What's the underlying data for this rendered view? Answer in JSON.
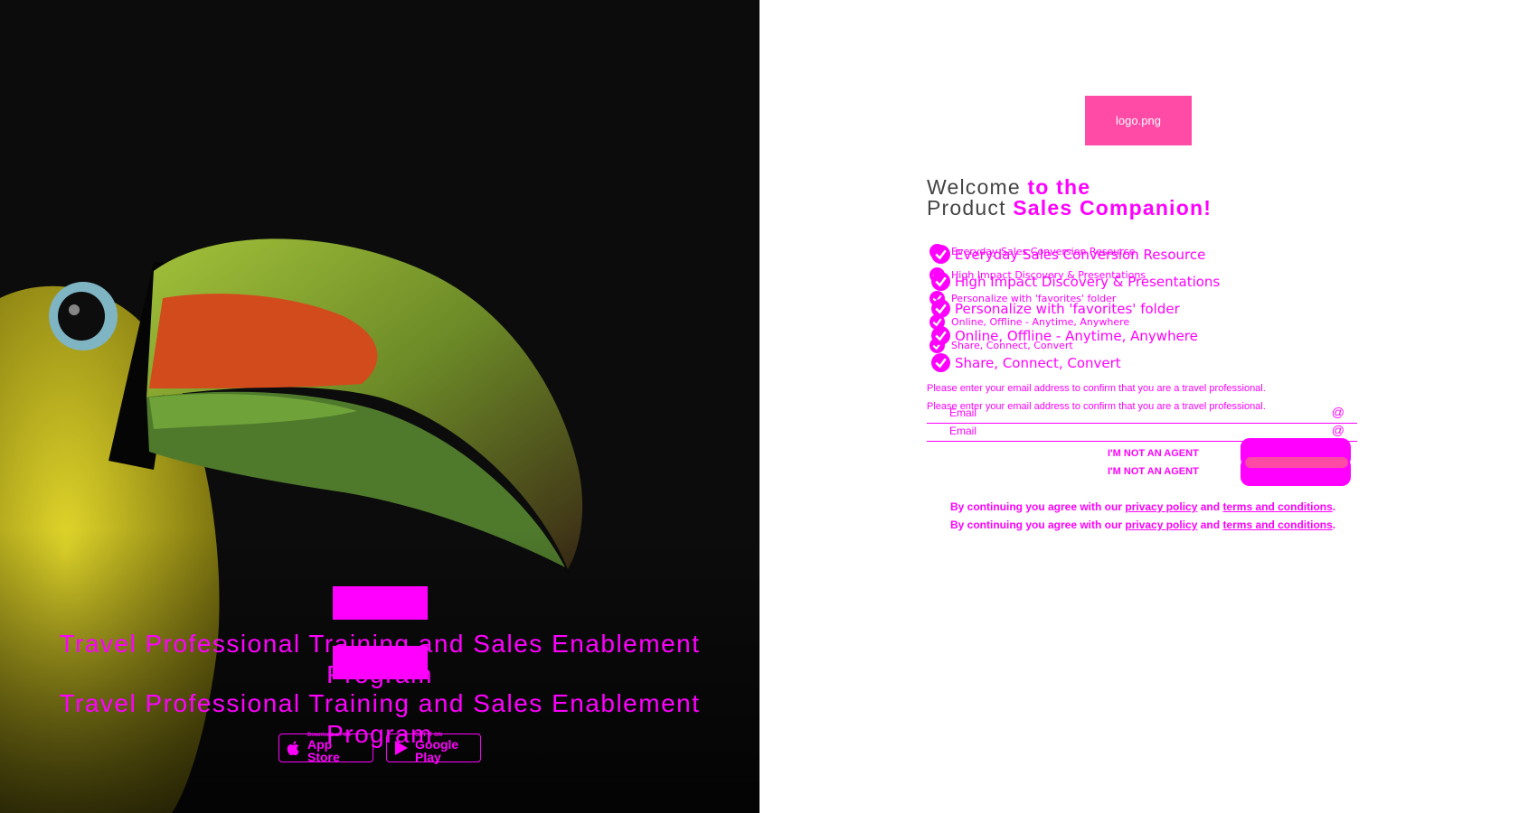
{
  "hero": {
    "tagline": "Travel Professional Training and Sales Enablement Program",
    "badges": {
      "apple": {
        "small": "Download on the",
        "big": "App Store",
        "icon": "apple-icon"
      },
      "google": {
        "small": "GET IT ON",
        "big": "Google Play",
        "icon": "google-play-icon"
      }
    }
  },
  "logo": {
    "alt": "logo.png"
  },
  "welcome": {
    "part1": "Welcome",
    "part2": "to the",
    "part3": "Product",
    "part4": "Sales Companion!"
  },
  "features": [
    "Everyday Sales Conversion Resource",
    "High Impact Discovery & Presentations",
    "Personalize with 'favorites' folder",
    "Online, Offline - Anytime, Anywhere",
    "Share, Connect, Convert"
  ],
  "form": {
    "instruction": "Please enter your email address to confirm that you are a travel professional.",
    "email_placeholder": "Email",
    "email_icon": "@",
    "not_agent": "I'M NOT AN AGENT"
  },
  "terms": {
    "prefix": "By continuing you agree with our",
    "privacy": "privacy policy",
    "and": "and",
    "conditions": "terms and conditions",
    "suffix": "."
  },
  "colors": {
    "accent": "#ff00ff",
    "logo_bg": "#ff4aa6",
    "left_bg": "#0c0c0c",
    "heading_gray": "#444444"
  }
}
